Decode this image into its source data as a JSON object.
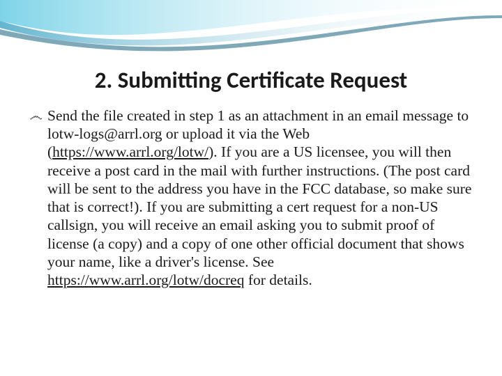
{
  "title": "2. Submitting Certificate Request",
  "bullet_glyph": "෴",
  "body": {
    "t1": "Send the file created in step 1 as an attachment in an email message to lotw-logs@arrl.org or upload it via the Web (",
    "link1": "https://www.arrl.org/lotw/",
    "t2": "). If you are a US licensee, you will then receive a post card in the mail with further instructions. (The post card will be sent to the address you have in the FCC database, so make sure that is correct!). If you are submitting a cert request for a non-US callsign, you will receive an email asking you to submit proof of license (a copy) and a copy of one other official document that shows your name, like a driver's license. See ",
    "link2": "https://www.arrl.org/lotw/docreq",
    "t3": " for details."
  }
}
